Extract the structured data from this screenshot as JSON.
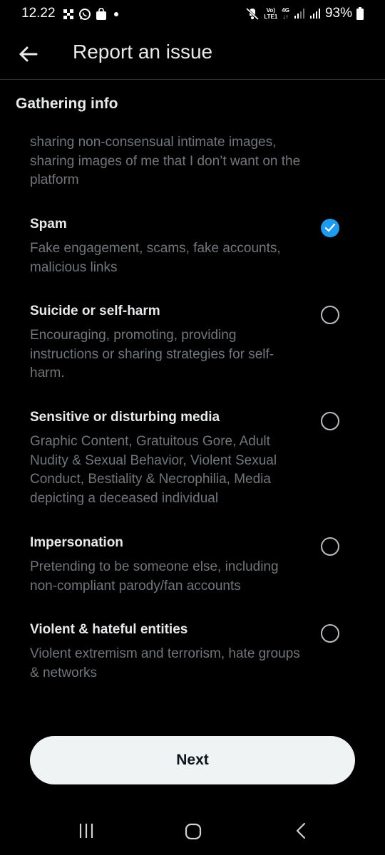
{
  "status_bar": {
    "time": "12.22",
    "network_top": "Vo)",
    "network_bottom": "LTE1",
    "network_type": "4G",
    "battery_percent": "93%",
    "left_icons": [
      "grid-notification-icon",
      "whatsapp-icon",
      "shopping-bag-icon",
      "dot-icon"
    ],
    "right_icons": [
      "mute-icon",
      "signal-icon",
      "battery-icon"
    ]
  },
  "header": {
    "title": "Report an issue",
    "back_icon": "arrow-left-icon"
  },
  "section": {
    "title": "Gathering info"
  },
  "truncated_item": {
    "description": "sharing non-consensual intimate images, sharing images of me that I don’t want on the platform"
  },
  "options": [
    {
      "label": "Spam",
      "description": "Fake engagement, scams, fake accounts, malicious links",
      "checked": true
    },
    {
      "label": "Suicide or self-harm",
      "description": "Encouraging, promoting, providing instructions or sharing strategies for self-harm.",
      "checked": false
    },
    {
      "label": "Sensitive or disturbing media",
      "description": "Graphic Content, Gratuitous Gore, Adult Nudity & Sexual Behavior, Violent Sexual Conduct, Bestiality & Necrophilia, Media depicting a deceased individual",
      "checked": false
    },
    {
      "label": "Impersonation",
      "description": "Pretending to be someone else, including non-compliant parody/fan accounts",
      "checked": false
    },
    {
      "label": "Violent & hateful entities",
      "description": "Violent extremism and terrorism, hate groups & networks",
      "checked": false
    }
  ],
  "footer": {
    "next_label": "Next"
  },
  "nav_bar": {
    "icons": [
      "recent-apps-icon",
      "home-icon",
      "back-icon"
    ]
  },
  "colors": {
    "background": "#000000",
    "primary_text": "#e7e9ea",
    "secondary_text": "#71767b",
    "accent": "#1d9bf0",
    "button_bg": "#eff3f4"
  }
}
